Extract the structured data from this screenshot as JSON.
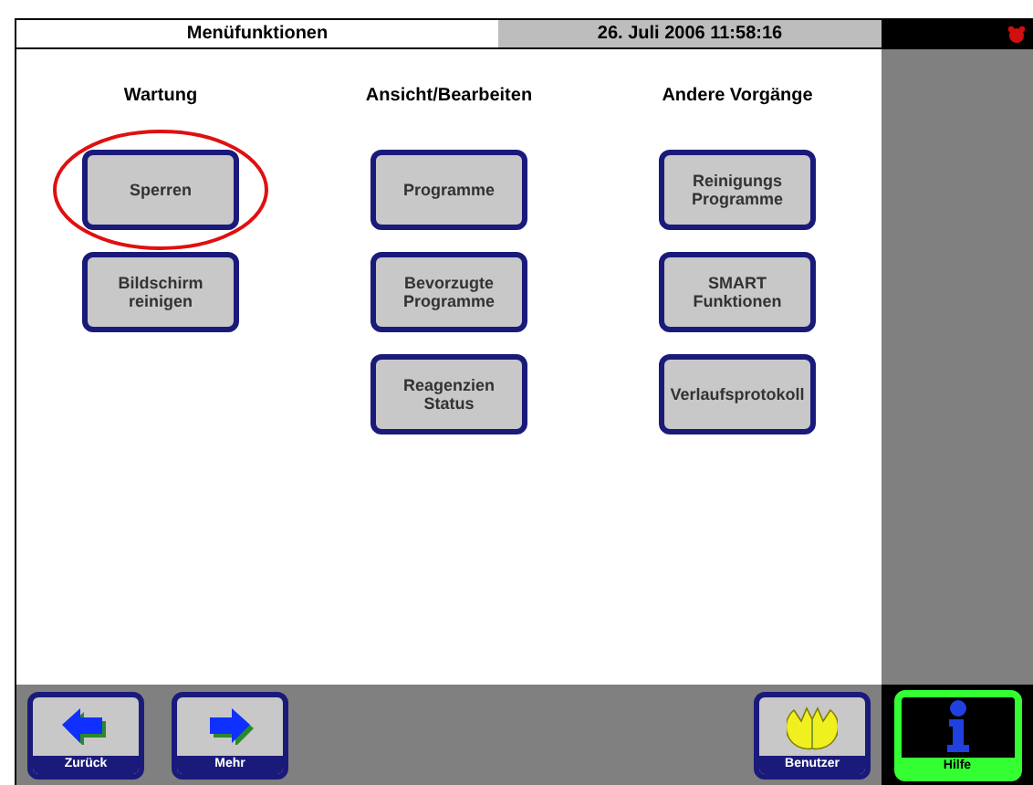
{
  "header": {
    "title": "Menüfunktionen",
    "datetime": "26. Juli 2006 11:58:16"
  },
  "columns": [
    {
      "heading": "Wartung",
      "buttons": [
        {
          "label": "Sperren",
          "highlighted": true
        },
        {
          "label": "Bildschirm reinigen",
          "highlighted": false
        }
      ]
    },
    {
      "heading": "Ansicht/Bearbeiten",
      "buttons": [
        {
          "label": "Programme",
          "highlighted": false
        },
        {
          "label": "Bevorzugte Programme",
          "highlighted": false
        },
        {
          "label": "Reagenzien Status",
          "highlighted": false
        }
      ]
    },
    {
      "heading": "Andere Vorgänge",
      "buttons": [
        {
          "label": "Reinigungs Programme",
          "highlighted": false
        },
        {
          "label": "SMART Funktionen",
          "highlighted": false
        },
        {
          "label": "Verlaufsprotokoll",
          "highlighted": false
        }
      ]
    }
  ],
  "nav_buttons": [
    {
      "label": "Zurück",
      "kind": "back"
    },
    {
      "label": "Mehr",
      "kind": "forward"
    }
  ],
  "user_button": {
    "label": "Benutzer"
  },
  "help_button": {
    "label": "Hilfe"
  }
}
